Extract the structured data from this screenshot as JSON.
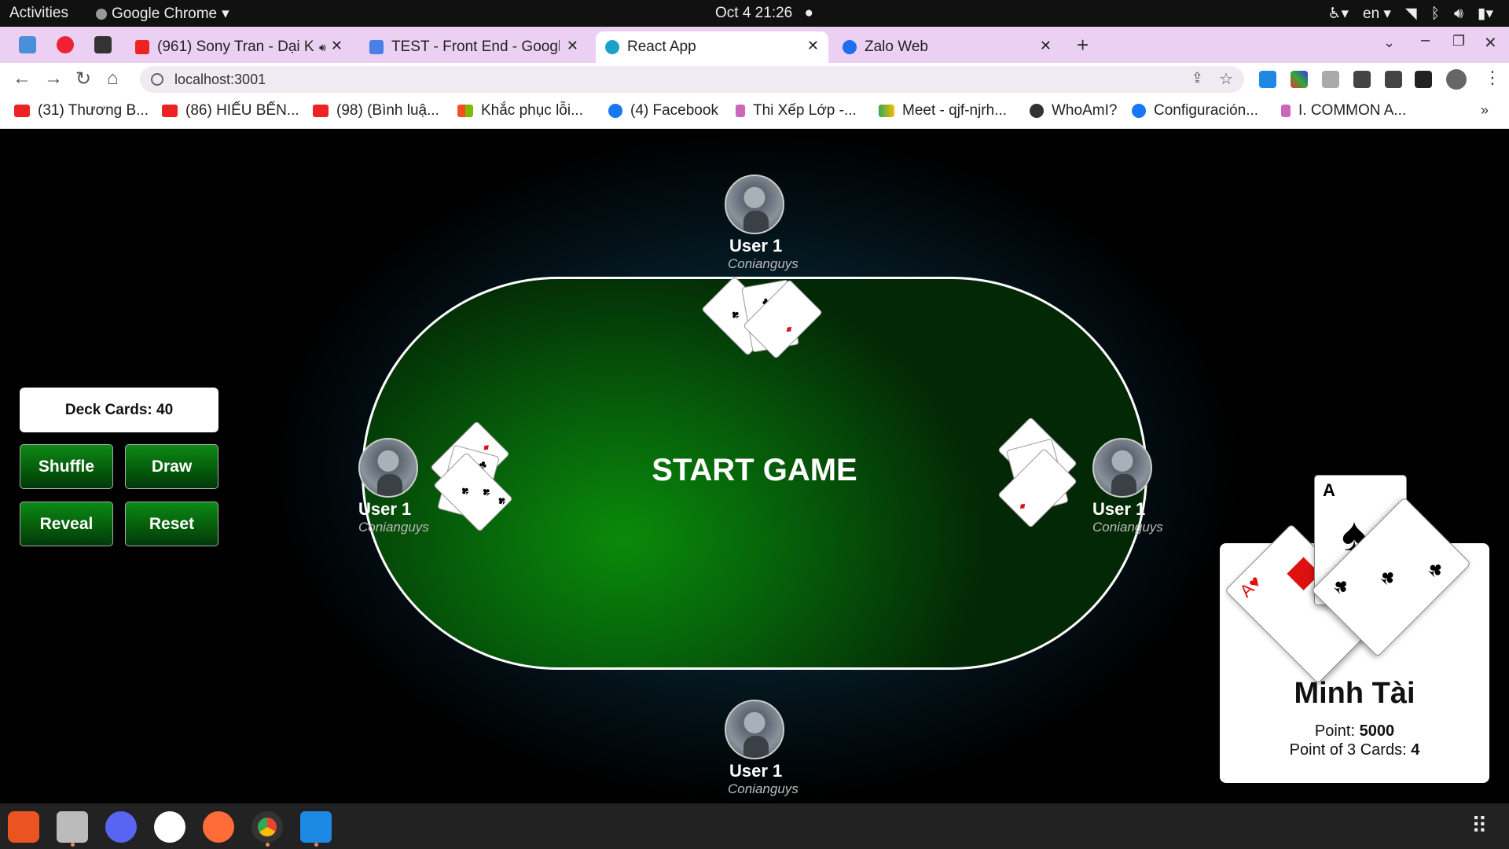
{
  "system": {
    "activities": "Activities",
    "app_menu": "Google Chrome",
    "clock": "Oct 4  21:26",
    "lang": "en"
  },
  "tabs": [
    {
      "title": "(961) Sony Tran - Dại K",
      "color": "#e22"
    },
    {
      "title": "TEST - Front End - Google",
      "color": "#4a7ee8"
    },
    {
      "title": "React App",
      "color": "#1ba1c9"
    },
    {
      "title": "Zalo Web",
      "color": "#1e6ef0"
    }
  ],
  "omnibox": {
    "url": "localhost:3001"
  },
  "bookmarks": [
    "(31) Thương B...",
    "(86) HIẾU BẾN...",
    "(98) (Bình luậ...",
    "Khắc phục lỗi...",
    "(4) Facebook",
    "Thi Xếp Lớp -...",
    "Meet - qjf-njrh...",
    "WhoAmI?",
    "Configuración...",
    "I. COMMON A..."
  ],
  "game": {
    "start_label": "START GAME",
    "deck_label": "Deck Cards: 40",
    "buttons": {
      "shuffle": "Shuffle",
      "draw": "Draw",
      "reveal": "Reveal",
      "reset": "Reset"
    },
    "players": {
      "top": {
        "name": "User 1",
        "handle": "Conianguys"
      },
      "left": {
        "name": "User 1",
        "handle": "Conianguys"
      },
      "right": {
        "name": "User 1",
        "handle": "Conianguys"
      },
      "bottom": {
        "name": "User 1",
        "handle": "Conianguys"
      }
    },
    "profile": {
      "name": "Minh Tài",
      "point_label": "Point: ",
      "point_value": "5000",
      "three_label": "Point of 3 Cards: ",
      "three_value": "4",
      "card_rank": "A"
    }
  }
}
